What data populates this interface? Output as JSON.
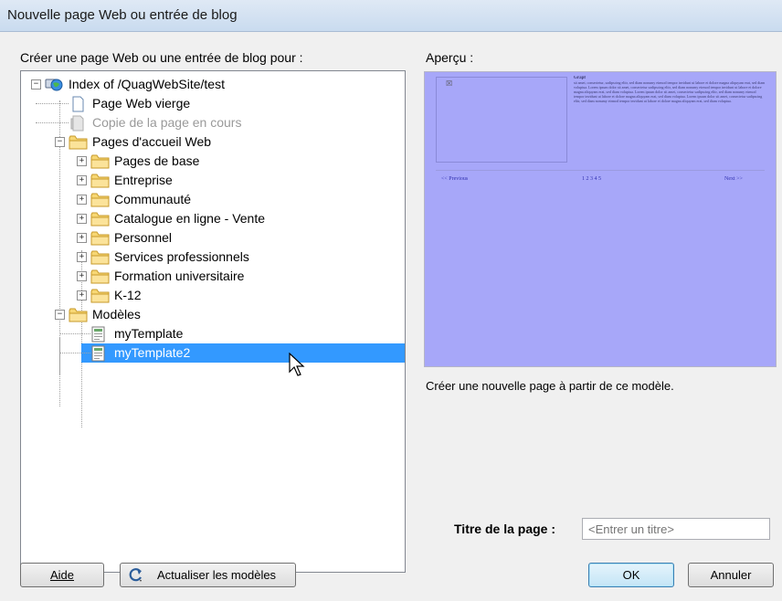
{
  "window": {
    "title": "Nouvelle page Web ou entrée de blog"
  },
  "left": {
    "label": "Créer une page Web ou une entrée de blog pour :"
  },
  "tree": [
    {
      "label": "Index of /QuagWebSite/test",
      "icon": "globe-computer-icon",
      "level": 0,
      "expander": "−"
    },
    {
      "label": "Page Web vierge",
      "icon": "blank-page-icon",
      "level": 1
    },
    {
      "label": "Copie de la page en cours",
      "icon": "copy-page-icon",
      "level": 1,
      "disabled": true
    },
    {
      "label": "Pages d'accueil Web",
      "icon": "folder-icon",
      "level": 1,
      "expander": "−"
    },
    {
      "label": "Pages de base",
      "icon": "folder-icon",
      "level": 2,
      "expander": "+"
    },
    {
      "label": "Entreprise",
      "icon": "folder-icon",
      "level": 2,
      "expander": "+"
    },
    {
      "label": "Communauté",
      "icon": "folder-icon",
      "level": 2,
      "expander": "+"
    },
    {
      "label": "Catalogue en ligne - Vente",
      "icon": "folder-icon",
      "level": 2,
      "expander": "+"
    },
    {
      "label": "Personnel",
      "icon": "folder-icon",
      "level": 2,
      "expander": "+"
    },
    {
      "label": "Services professionnels",
      "icon": "folder-icon",
      "level": 2,
      "expander": "+"
    },
    {
      "label": "Formation universitaire",
      "icon": "folder-icon",
      "level": 2,
      "expander": "+"
    },
    {
      "label": "K-12",
      "icon": "folder-icon",
      "level": 2,
      "expander": "+"
    },
    {
      "label": "Modèles",
      "icon": "folder-icon",
      "level": 1,
      "expander": "−"
    },
    {
      "label": "myTemplate",
      "icon": "template-icon",
      "level": 2
    },
    {
      "label": "myTemplate2",
      "icon": "template-icon",
      "level": 2,
      "selected": true
    }
  ],
  "preview": {
    "label": "Aperçu :",
    "heading": "Grapf",
    "body": "sit amet, consectetur, sadipscing elitr, sed diam nonumy eirmod tempor invidunt ut labore et dolore magna aliquyam erat, sed diam voluptua. Lorem ipsum dolor sit amet, consectetur sadipscing elitr, sed diam nonumy eirmod tempor invidunt ut labore et dolore magna aliquyam erat, sed diam voluptua. Lorem ipsum dolor sit amet, consectetur sadipscing elitr, sed diam nonumy eirmod tempor invidunt ut labore et dolore magna aliquyam erat, sed diam voluptua. Lorem ipsum dolor sit amet, consectetur sadipscing elitr, sed diam nonumy eirmod tempor invidunt ut labore et dolore magna aliquyam erat, sed diam voluptua.",
    "prev": "<< Previous",
    "pages": "1 2 3 4 5",
    "next": "Next >>"
  },
  "description": "Créer une nouvelle page à partir de ce modèle.",
  "page_title": {
    "label": "Titre de la page :",
    "placeholder": "<Entrer un titre>"
  },
  "buttons": {
    "help": "Aide",
    "refresh": "Actualiser les modèles",
    "ok": "OK",
    "cancel": "Annuler"
  }
}
